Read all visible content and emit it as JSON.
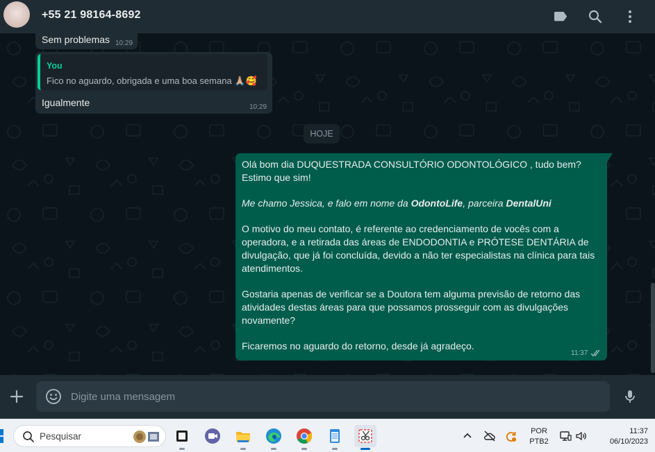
{
  "header": {
    "contact_name": "+55 21 98164-8692"
  },
  "messages": {
    "prev_message": {
      "text": "Sem problemas",
      "time": "10:29"
    },
    "reply_message": {
      "quote_author": "You",
      "quote_text": "Fico no aguardo, obrigada e uma boa semana 🙏🏼🥰",
      "text": "Igualmente",
      "time": "10:29"
    },
    "date_divider": "HOJE",
    "outgoing": {
      "p1": "Olá bom dia DUQUESTRADA CONSULTÓRIO ODONTOLÓGICO , tudo bem? Estimo que sim!",
      "p2_intro": "Me chamo Jessica, e falo em nome da ",
      "p2_brand1": "OdontoLife",
      "p2_mid": ", parceira ",
      "p2_brand2": "DentalUni",
      "p3": "O motivo do meu contato, é referente ao credenciamento de vocês com a operadora, e a retirada das áreas de ENDODONTIA e PRÓTESE DENTÁRIA de divulgação, que já foi concluída, devido a não ter especialistas na clínica para tais atendimentos.",
      "p4": "Gostaria apenas de verificar se a Doutora tem alguma previsão de retorno das atividades destas áreas para que possamos prosseguir com as divulgações novamente?",
      "p5": "Ficaremos no aguardo do retorno, desde já agradeço.",
      "time": "11:37",
      "status": "read"
    }
  },
  "composer": {
    "placeholder": "Digite uma mensagem"
  },
  "taskbar": {
    "search_label": "Pesquisar",
    "language_line1": "POR",
    "language_line2": "PTB2",
    "clock_time": "11:37",
    "clock_date": "06/10/2023"
  },
  "colors": {
    "header_bg": "#202c33",
    "chat_bg": "#0b141a",
    "incoming_bubble": "#202c33",
    "outgoing_bubble": "#005c4b",
    "accent_green": "#06cf9c",
    "taskbar_bg": "#eef1f6"
  },
  "icons": [
    "label-icon",
    "search-icon",
    "menu-icon",
    "plus-icon",
    "emoji-icon",
    "mic-icon",
    "double-check-icon",
    "windows-search-icon",
    "terminal-icon",
    "video-icon",
    "folder-icon",
    "edge-icon",
    "chrome-icon",
    "notepad-icon",
    "snipping-icon",
    "chevron-up-icon",
    "cloud-icon",
    "sync-icon",
    "display-icon",
    "speaker-icon"
  ]
}
